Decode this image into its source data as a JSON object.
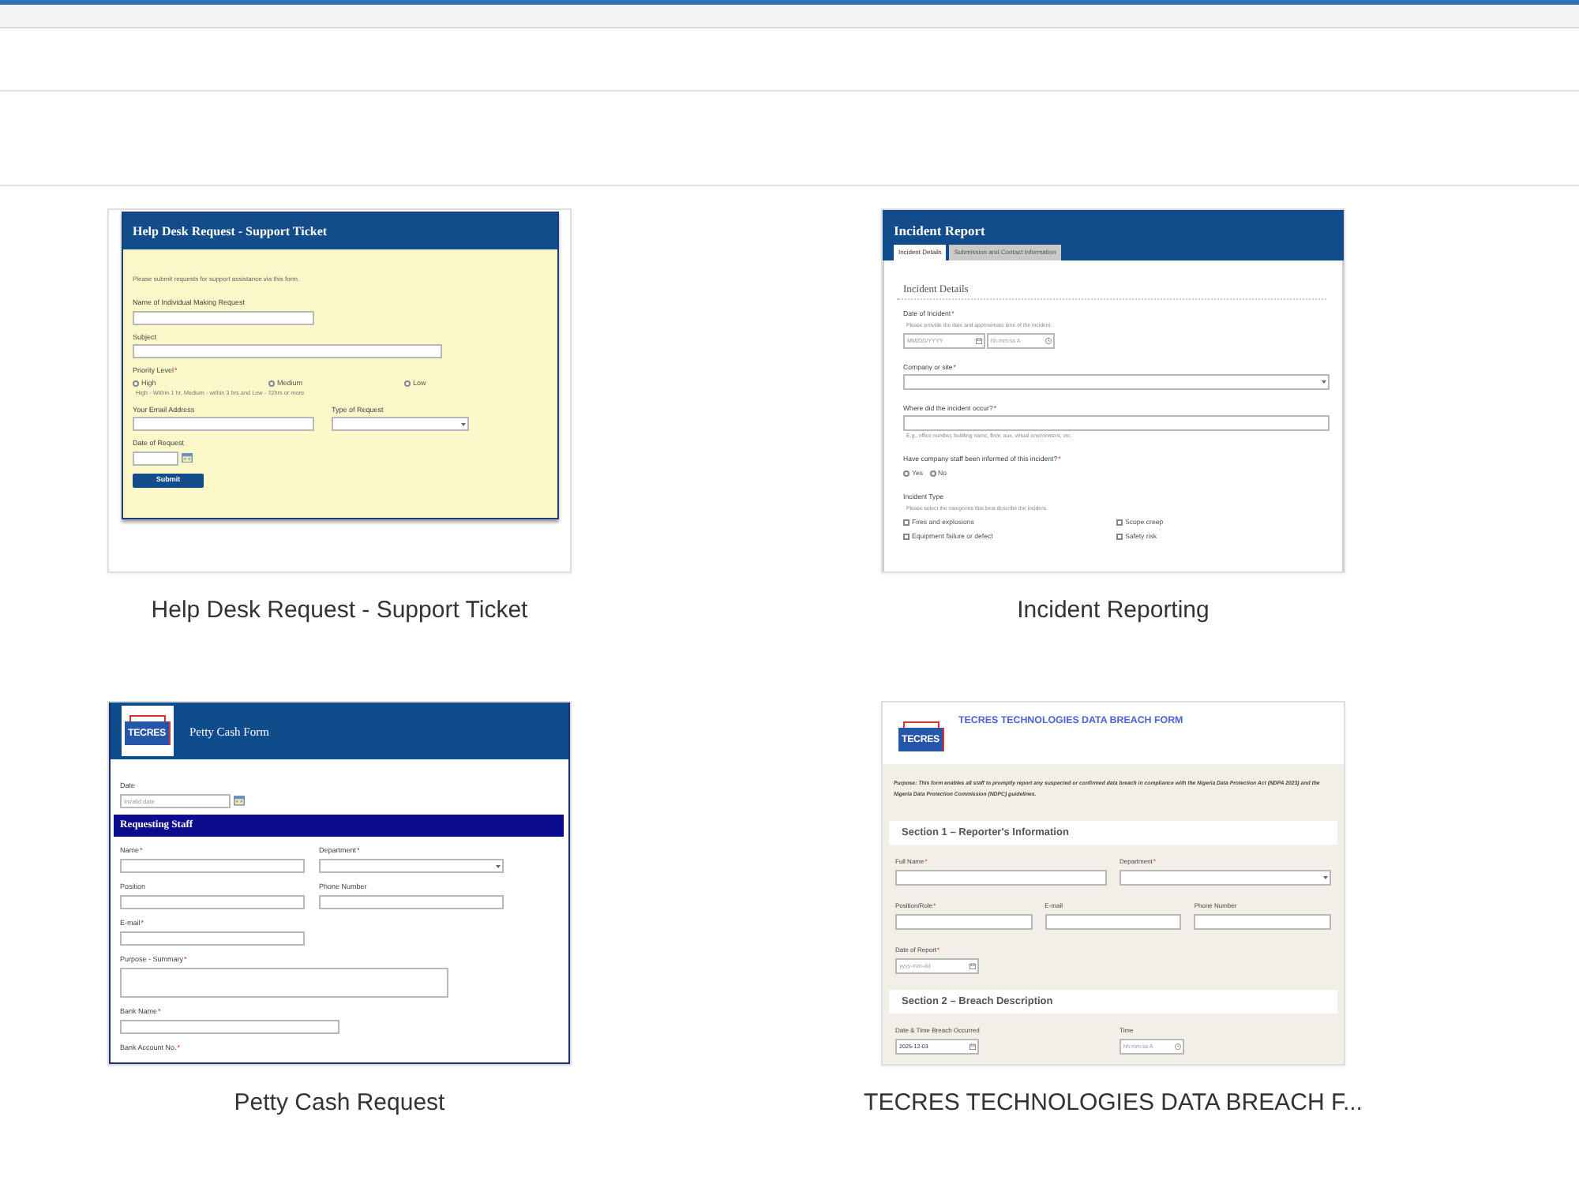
{
  "templates": [
    {
      "kind": "help_desk",
      "caption": "Help Desk Request - Support Ticket",
      "preview": {
        "title": "Help Desk Request - Support Ticket",
        "intro": "Please submit requests for support assistance via this form.",
        "blocks": [
          {
            "kind": "row",
            "fields": [
              {
                "kind": "text",
                "label": "Name of Individual Making Request"
              }
            ]
          },
          {
            "kind": "row",
            "fields": [
              {
                "kind": "long_text",
                "label": "Subject"
              }
            ]
          },
          {
            "kind": "row",
            "fields": [
              {
                "kind": "radio",
                "label": "Priority Level",
                "required_mark": "*",
                "options": [
                  {
                    "label": "High",
                    "selected": false
                  },
                  {
                    "label": "Medium",
                    "selected": false
                  },
                  {
                    "label": "Low",
                    "selected": false
                  }
                ],
                "hint": "High - Within 1 hr, Medium - within 3 hrs and Low - 72hrs or more"
              }
            ]
          },
          {
            "kind": "row",
            "fields": [
              {
                "kind": "text",
                "label": "Your Email Address"
              },
              {
                "kind": "select",
                "label": "Type of Request"
              }
            ]
          },
          {
            "kind": "row",
            "fields": [
              {
                "kind": "date_side",
                "label": "Date of Request"
              }
            ]
          }
        ],
        "submit": "Submit"
      }
    },
    {
      "kind": "incident",
      "caption": "Incident Reporting",
      "preview": {
        "title": "Incident Report",
        "tabs": [
          {
            "label": "Incident Details",
            "selected": true
          },
          {
            "label": "Submission and Contact Information",
            "selected": false
          }
        ],
        "heading": "Incident Details",
        "blocks": [
          {
            "kind": "row",
            "fields": [
              {
                "kind": "date_time",
                "label": "Date of Incident",
                "required_mark": "*",
                "note": "Please provide the date and approximate time of the incident.",
                "placeholder": "MM/DD/YYYY",
                "time_placeholder": "hh:mm:ss A"
              }
            ]
          },
          {
            "kind": "row",
            "fields": [
              {
                "kind": "select",
                "label": "Company or site",
                "required_mark": "*"
              }
            ]
          },
          {
            "kind": "row",
            "fields": [
              {
                "kind": "text",
                "label": "Where did the incident occur?",
                "required_mark": "*",
                "hint": "E.g., office number, building name, floor, aux, virtual environment, etc."
              }
            ]
          },
          {
            "kind": "row",
            "fields": [
              {
                "kind": "radio",
                "label": "Have company staff been informed of this incident?",
                "required_mark": "*",
                "options": [
                  {
                    "label": "Yes",
                    "selected": false
                  },
                  {
                    "label": "No",
                    "selected": false
                  }
                ]
              }
            ]
          },
          {
            "kind": "row",
            "fields": [
              {
                "kind": "checkbox",
                "label": "Incident Type",
                "note": "Please select the categories that best describe the incident.",
                "options": [
                  {
                    "label": "Fires and explosions",
                    "checked": false
                  },
                  {
                    "label": "Scope creep",
                    "checked": false
                  },
                  {
                    "label": "Equipment failure or defect",
                    "checked": false
                  },
                  {
                    "label": "Safety risk",
                    "checked": false
                  }
                ]
              }
            ]
          }
        ]
      }
    },
    {
      "kind": "petty_cash",
      "caption": "Petty Cash Request",
      "preview": {
        "logo": "TECRES",
        "title": "Petty Cash Form",
        "blocks": [
          {
            "kind": "row",
            "fields": [
              {
                "kind": "date_side",
                "label": "Date",
                "placeholder": "Invalid date"
              }
            ]
          },
          {
            "kind": "section",
            "title": "Requesting Staff"
          },
          {
            "kind": "row",
            "fields": [
              {
                "kind": "text",
                "label": "Name",
                "required_mark": "*"
              },
              {
                "kind": "select",
                "label": "Department",
                "required_mark": "*"
              }
            ]
          },
          {
            "kind": "row",
            "fields": [
              {
                "kind": "text",
                "label": "Position"
              },
              {
                "kind": "text",
                "label": "Phone Number"
              }
            ]
          },
          {
            "kind": "row",
            "fields": [
              {
                "kind": "text",
                "label": "E-mail",
                "required_mark": "*"
              }
            ]
          },
          {
            "kind": "row",
            "fields": [
              {
                "kind": "textarea",
                "label": "Purpose - Summary",
                "required_mark": "*"
              }
            ]
          },
          {
            "kind": "row",
            "fields": [
              {
                "kind": "long_text",
                "label": "Bank Name",
                "required_mark": "*"
              }
            ]
          },
          {
            "kind": "row",
            "fields": [
              {
                "kind": "label_only",
                "label": "Bank Account No.",
                "required_mark": "*"
              }
            ]
          }
        ]
      }
    },
    {
      "kind": "data_breach",
      "caption": "TECRES TECHNOLOGIES DATA BREACH F...",
      "preview": {
        "logo": "TECRES",
        "title": "TECRES TECHNOLOGIES DATA BREACH FORM",
        "intro": "Purpose: This form enables all staff to promptly report any suspected or confirmed data breach in compliance with the Nigeria Data Protection Act (NDPA 2023) and the Nigeria Data Protection Commission (NDPC) guidelines.",
        "blocks": [
          {
            "kind": "section",
            "title": "Section 1 – Reporter's Information"
          },
          {
            "kind": "row",
            "fields": [
              {
                "kind": "text",
                "label": "Full Name",
                "required_mark": "*"
              },
              {
                "kind": "select",
                "label": "Department",
                "required_mark": "*"
              }
            ]
          },
          {
            "kind": "row",
            "fields": [
              {
                "kind": "text",
                "label": "Position/Role",
                "required_mark": "*"
              },
              {
                "kind": "text",
                "label": "E-mail"
              },
              {
                "kind": "text",
                "label": "Phone Number"
              }
            ]
          },
          {
            "kind": "row",
            "fields": [
              {
                "kind": "date",
                "label": "Date of Report",
                "required_mark": "*",
                "placeholder": "yyyy-mm-dd"
              }
            ]
          },
          {
            "kind": "section",
            "title": "Section 2 – Breach Description"
          },
          {
            "kind": "row",
            "fields": [
              {
                "kind": "date",
                "label": "Date & Time Breach Occurred",
                "value": "2025-12-03"
              },
              {
                "kind": "time",
                "label": "Time",
                "placeholder": "hh:mm:ss A"
              }
            ]
          }
        ]
      }
    }
  ]
}
